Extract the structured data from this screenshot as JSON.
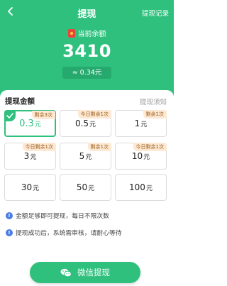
{
  "header": {
    "title": "提现",
    "record_link": "提现记录",
    "balance_label": "当前余额",
    "balance": "3410",
    "approx_symbol": "≈",
    "balance_yuan": "0.34元",
    "accent": "#2fc07e"
  },
  "panel": {
    "title": "提现金额",
    "notice_link": "提现须知",
    "options": [
      {
        "amount": "0.3",
        "unit": "元",
        "tag": "剩余3次",
        "selected": true
      },
      {
        "amount": "0.5",
        "unit": "元",
        "tag": "今日剩余1次",
        "selected": false
      },
      {
        "amount": "1",
        "unit": "元",
        "tag": "剩余1次",
        "selected": false
      },
      {
        "amount": "3",
        "unit": "元",
        "tag": "今日剩余1次",
        "selected": false
      },
      {
        "amount": "5",
        "unit": "元",
        "tag": "剩余1次",
        "selected": false
      },
      {
        "amount": "10",
        "unit": "元",
        "tag": "今日剩余1次",
        "selected": false
      },
      {
        "amount": "30",
        "unit": "元",
        "tag": "",
        "selected": false
      },
      {
        "amount": "50",
        "unit": "元",
        "tag": "",
        "selected": false
      },
      {
        "amount": "100",
        "unit": "元",
        "tag": "",
        "selected": false
      }
    ]
  },
  "info": {
    "line1": "金额足够即可提现，每日不限次数",
    "line2": "提现成功后，系统需审核，请耐心等待",
    "icon": "!"
  },
  "button": {
    "label": "微信提现"
  }
}
